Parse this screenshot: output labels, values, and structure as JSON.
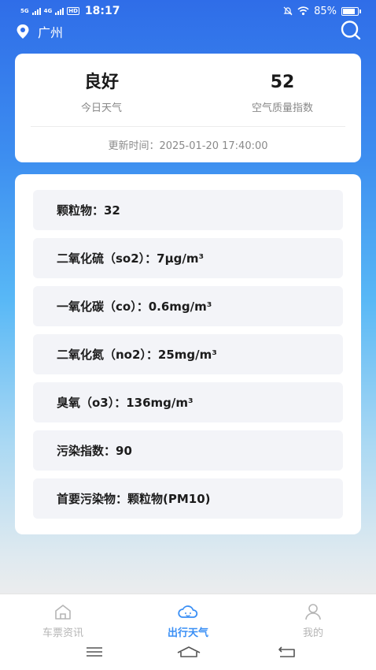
{
  "status_bar": {
    "network_1": "5G",
    "network_2": "4G",
    "hd": "HD",
    "time": "18:17",
    "battery": "85%"
  },
  "header": {
    "city": "广州"
  },
  "summary": {
    "quality_value": "良好",
    "quality_label": "今日天气",
    "aqi_value": "52",
    "aqi_label": "空气质量指数",
    "update_time": "更新时间：2025-01-20 17:40:00"
  },
  "details": [
    "颗粒物：32",
    "二氧化硫（so2）：7μg/m³",
    "一氧化碳（co）：0.6mg/m³",
    "二氧化氮（no2）：25mg/m³",
    "臭氧（o3）：136mg/m³",
    "污染指数：90",
    "首要污染物：颗粒物(PM10)"
  ],
  "tabs": [
    {
      "label": "车票资讯",
      "icon": "home-icon",
      "active": false
    },
    {
      "label": "出行天气",
      "icon": "weather-cloud-icon",
      "active": true
    },
    {
      "label": "我的",
      "icon": "user-icon",
      "active": false
    }
  ],
  "colors": {
    "accent": "#3a8ff5",
    "gradient_top": "#2f6de8",
    "gradient_mid": "#58b8f6",
    "card_row_bg": "#f3f4f8"
  }
}
